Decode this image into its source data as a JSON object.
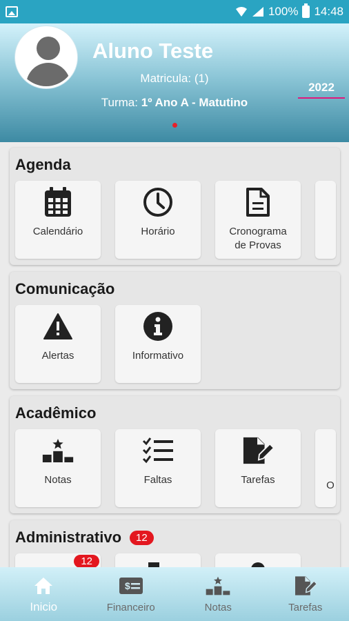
{
  "status_bar": {
    "battery": "100%",
    "time": "14:48"
  },
  "profile": {
    "name": "Aluno Teste",
    "enrollment": "Matricula: (1)",
    "class_label": "Turma:",
    "class_value": "1º Ano A - Matutino",
    "year": "2022"
  },
  "sections": {
    "agenda": {
      "title": "Agenda",
      "tiles": [
        {
          "label": "Calendário",
          "icon": "calendar-icon"
        },
        {
          "label": "Horário",
          "icon": "clock-icon"
        },
        {
          "label": "Cronograma de Provas",
          "icon": "document-icon"
        }
      ]
    },
    "comunicacao": {
      "title": "Comunicação",
      "tiles": [
        {
          "label": "Alertas",
          "icon": "warning-icon"
        },
        {
          "label": "Informativo",
          "icon": "info-icon"
        }
      ]
    },
    "academico": {
      "title": "Acadêmico",
      "tiles": [
        {
          "label": "Notas",
          "icon": "podium-icon"
        },
        {
          "label": "Faltas",
          "icon": "checklist-icon"
        },
        {
          "label": "Tarefas",
          "icon": "edit-document-icon"
        },
        {
          "label": "O",
          "icon": ""
        }
      ]
    },
    "administrativo": {
      "title": "Administrativo",
      "badge": "12",
      "tile_badge": "12"
    }
  },
  "bottom_nav": {
    "items": [
      {
        "label": "Inicio",
        "icon": "home-icon",
        "active": true
      },
      {
        "label": "Financeiro",
        "icon": "money-icon"
      },
      {
        "label": "Notas",
        "icon": "podium-icon"
      },
      {
        "label": "Tarefas",
        "icon": "edit-document-icon"
      }
    ]
  },
  "colors": {
    "status_bar": "#2aa4c2",
    "badge": "#e3171f",
    "year_underline": "#e0187c",
    "icon": "#222222"
  }
}
